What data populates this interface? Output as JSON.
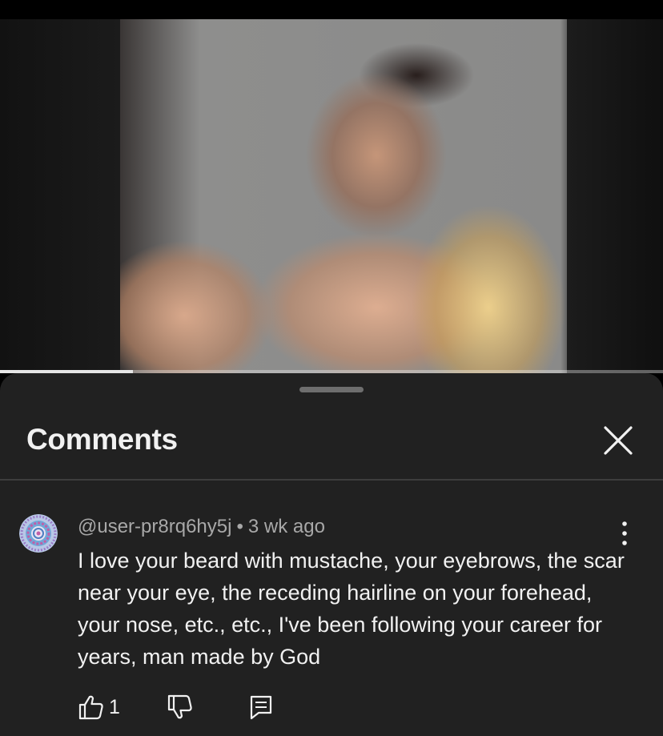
{
  "video": {
    "progress_fraction": 0.2
  },
  "comments_panel": {
    "title": "Comments",
    "close_icon": "close-icon"
  },
  "comment": {
    "author": "@user-pr8rq6hy5j",
    "separator": "•",
    "time": "3 wk ago",
    "text": "I love your beard with mustache, your eyebrows, the scar near your eye, the receding hairline on your forehead, your nose, etc., etc., I've been following your career for years, man made by God",
    "like_count": "1",
    "icons": {
      "like": "thumb-up-icon",
      "dislike": "thumb-down-icon",
      "reply": "reply-icon",
      "more": "more-vertical-icon",
      "avatar": "mandala-avatar-icon"
    }
  },
  "colors": {
    "sheet_background": "#212121",
    "primary_text": "#f1f1f1",
    "secondary_text": "#a8a8a8"
  }
}
